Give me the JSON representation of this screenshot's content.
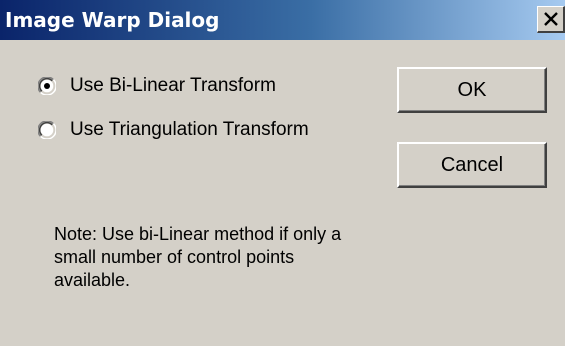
{
  "window": {
    "title": "Image Warp Dialog",
    "close_icon": "close-icon"
  },
  "options": [
    {
      "label": "Use Bi-Linear Transform",
      "selected": true
    },
    {
      "label": "Use Triangulation Transform",
      "selected": false
    }
  ],
  "buttons": {
    "ok_label": "OK",
    "cancel_label": "Cancel"
  },
  "note": {
    "line1": "Note: Use bi-Linear method if only a",
    "line2": "small number of control points",
    "line3": "available."
  },
  "colors": {
    "dialog_bg": "#d4d0c8",
    "titlebar_start": "#0a246a",
    "titlebar_end": "#a6caf0",
    "title_text": "#ffffff"
  }
}
